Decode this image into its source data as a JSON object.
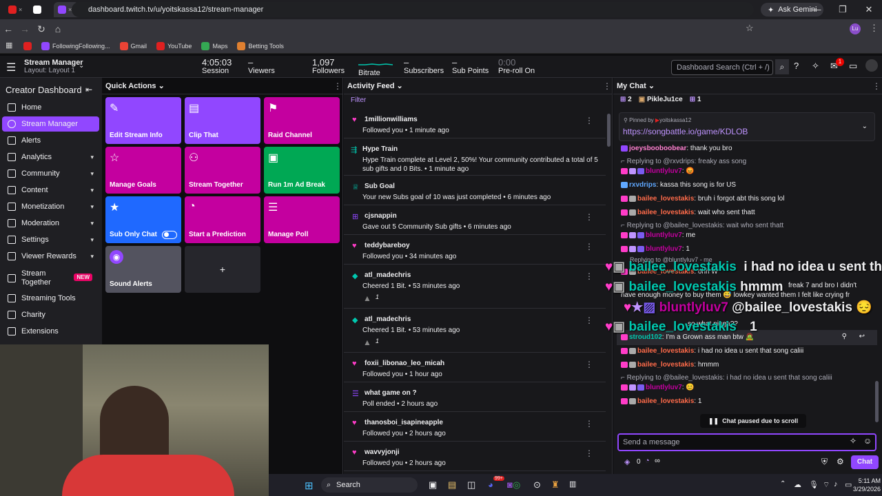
{
  "browser": {
    "ask_gemini": "Ask Gemini",
    "url": "dashboard.twitch.tv/u/yoitskassa12/stream-manager",
    "bookmarks": [
      "FollowingFollowing...",
      "Gmail",
      "YouTube",
      "Maps",
      "Betting Tools"
    ],
    "profile_initials": "Lu"
  },
  "header": {
    "title": "Stream Manager",
    "layout": "Layout: Layout 1",
    "session_value": "4:05:03",
    "session_label": "Session",
    "viewers_value": "–",
    "viewers_label": "Viewers",
    "followers_value": "1,097",
    "followers_label": "Followers",
    "bitrate_label": "Bitrate",
    "subs_value": "–",
    "subs_label": "Subscribers",
    "subpoints_value": "–",
    "subpoints_label": "Sub Points",
    "preroll_value": "0:00",
    "preroll_label": "Pre-roll On",
    "search_placeholder": "Dashboard Search (Ctrl + /)",
    "notif_count": "1"
  },
  "sidebar": {
    "title": "Creator Dashboard",
    "items": [
      {
        "label": "Home"
      },
      {
        "label": "Stream Manager"
      },
      {
        "label": "Alerts"
      },
      {
        "label": "Analytics"
      },
      {
        "label": "Community"
      },
      {
        "label": "Content"
      },
      {
        "label": "Monetization"
      },
      {
        "label": "Moderation"
      },
      {
        "label": "Settings"
      },
      {
        "label": "Viewer Rewards"
      },
      {
        "label": "Stream Together"
      },
      {
        "label": "Streaming Tools"
      },
      {
        "label": "Charity"
      },
      {
        "label": "Extensions"
      }
    ],
    "new_badge": "NEW"
  },
  "quick_actions": {
    "title": "Quick Actions",
    "tiles": [
      {
        "label": "Edit Stream Info",
        "color": "#9147ff"
      },
      {
        "label": "Clip That",
        "color": "#9147ff"
      },
      {
        "label": "Raid Channel",
        "color": "#c4009f"
      },
      {
        "label": "Manage Goals",
        "color": "#c4009f"
      },
      {
        "label": "Stream Together",
        "color": "#c4009f"
      },
      {
        "label": "Run 1m Ad Break",
        "color": "#00a854"
      },
      {
        "label": "Sub Only Chat",
        "color": "#1f69ff"
      },
      {
        "label": "Start a Prediction",
        "color": "#c4009f"
      },
      {
        "label": "Manage Poll",
        "color": "#c4009f"
      },
      {
        "label": "Sound Alerts",
        "color": "#53535f"
      }
    ],
    "add": "+"
  },
  "feed": {
    "title": "Activity Feed",
    "filter": "Filter",
    "items": [
      {
        "user": "1millionwilliams",
        "detail": "Followed you • 1 minute ago"
      },
      {
        "user": "Hype Train",
        "detail": "Hype Train complete at Level 2, 50%! Your community contributed a total of 5",
        "detail2": "sub gifts and 0 Bits. • 1 minute ago"
      },
      {
        "user": "Sub Goal",
        "detail": "Your new Subs goal of 10 was just completed • 6 minutes ago"
      },
      {
        "user": "cjsnappin",
        "detail": "Gave out 5 Community Sub gifts • 6 minutes ago"
      },
      {
        "user": "teddybareboy",
        "detail": "Followed you • 34 minutes ago"
      },
      {
        "user": "atl_madechris",
        "detail": "Cheered 1 Bit. • 53 minutes ago",
        "bits": "1"
      },
      {
        "user": "atl_madechris",
        "detail": "Cheered 1 Bit. • 53 minutes ago",
        "bits": "1"
      },
      {
        "user": "foxii_libonao_leo_micah",
        "detail": "Followed you • 1 hour ago"
      },
      {
        "user": "what game on ?",
        "detail": "Poll ended • 2 hours ago"
      },
      {
        "user": "thanosboi_isapineapple",
        "detail": "Followed you • 2 hours ago"
      },
      {
        "user": "wavvyjonji",
        "detail": "Followed you • 2 hours ago"
      }
    ]
  },
  "chat": {
    "title": "My Chat",
    "count1": "2",
    "user": "PikleJu1ce",
    "count2": "1",
    "pinned_by": "Pinned by",
    "pinned_user": "yoitskassa12",
    "pinned_link": "https://songbattle.io/game/KDLOB",
    "lines": [
      {
        "user": "joeysbooboobear",
        "msg": ": thank you bro",
        "color": "#ff7fd0"
      },
      {
        "reply": "Replying to @rxvdrips: freaky ass song"
      },
      {
        "user": "bluntlyluv7",
        "msg": ": 😡",
        "color": "#c4009f"
      },
      {
        "user": "rxvdrips",
        "msg": ": kassa this song is for US",
        "color": "#5fa8ff"
      },
      {
        "user": "bailee_lovestakis",
        "msg": ": bruh i forgot abt this song lol",
        "color": "#ff6b4a"
      },
      {
        "user": "bailee_lovestakis",
        "msg": ": wait who sent thatt",
        "color": "#ff6b4a"
      },
      {
        "reply": "Replying to @bailee_lovestakis: wait who sent thatt"
      },
      {
        "user": "bluntlyluv7",
        "msg": ": me",
        "color": "#c4009f"
      },
      {
        "user": "bluntlyluv7",
        "msg": ": 1",
        "color": "#c4009f"
      },
      {
        "user": "bailee_lovestakis",
        "msg": ": ohh W",
        "color": "#ff6b4a"
      },
      {
        "msg": "have enough money to buy them 😅 lowkey wanted them I felt like crying fr"
      },
      {
        "user": "stroud102",
        "msg": ": I'm a Grown ass man btw 🧟",
        "color": "#00c8af"
      },
      {
        "user": "bailee_lovestakis",
        "msg": ": i had no idea u sent that song caliii",
        "color": "#ff6b4a"
      },
      {
        "user": "bailee_lovestakis",
        "msg": ": hmmm",
        "color": "#ff6b4a"
      },
      {
        "reply": "Replying to @bailee_lovestakis: i had no idea u sent that song caliii"
      },
      {
        "user": "bluntlyluv7",
        "msg": ": 😊",
        "color": "#c4009f"
      },
      {
        "user": "bailee_lovestakis",
        "msg": ": 1",
        "color": "#ff6b4a"
      }
    ],
    "overlay": [
      {
        "user": "bailee_lovestakis",
        "msg": "i had no idea u sent that"
      },
      {
        "user": "bailee_lovestakis",
        "msg": "hmmm"
      },
      {
        "user": "bluntlyluv7",
        "msg": "@bailee_lovestakis 😔"
      },
      {
        "user": "bailee_lovestakis",
        "msg": "1"
      }
    ],
    "overlay_fragments": {
      "freak": "freak 7 and bro I didn't",
      "replying": "Replying to @bluntlyluv7 - me",
      "what_nigga": "so what nigga??"
    },
    "paused": "Chat paused due to scroll",
    "placeholder": "Send a message",
    "points": "0",
    "chat_button": "Chat"
  },
  "taskbar": {
    "search": "Search",
    "time": "5:11 AM",
    "date": "3/29/2026",
    "badge": "99+"
  }
}
